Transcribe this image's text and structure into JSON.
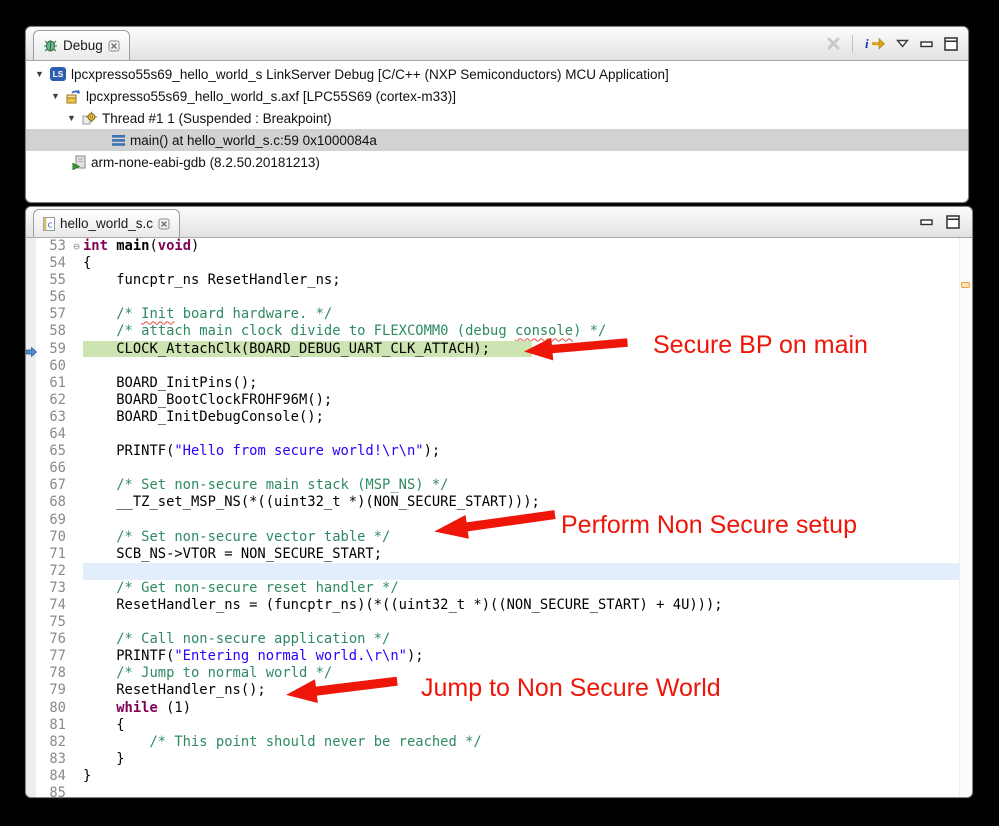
{
  "colors": {
    "annotation_red": "#ee1509",
    "exec_line_green": "#cde4b2",
    "current_line_blue": "#e2eefb",
    "selected_row_gray": "#d2d2d2",
    "keyword_purple": "#7f0055",
    "comment_green": "#2f8a62",
    "string_blue": "#2a00ff",
    "overview_marker_orange": "#efa23a"
  },
  "debug_view": {
    "tab_label": "Debug",
    "toolbar_icons": [
      "remove-all-terminated",
      "restart-i-arrow",
      "view-menu",
      "minimize",
      "maximize"
    ],
    "tree": [
      {
        "icon": "linkserver",
        "pad": 8,
        "expanded": true,
        "label": "lpcxpresso55s69_hello_world_s LinkServer Debug [C/C++ (NXP Semiconductors) MCU Application]"
      },
      {
        "icon": "executable",
        "pad": 24,
        "expanded": true,
        "label": "lpcxpresso55s69_hello_world_s.axf [LPC55S69 (cortex-m33)]"
      },
      {
        "icon": "thread",
        "pad": 40,
        "expanded": true,
        "label": "Thread #1 1 (Suspended : Breakpoint)"
      },
      {
        "icon": "stack-frame",
        "pad": 86,
        "selected": true,
        "label": "main() at hello_world_s.c:59 0x1000084a"
      },
      {
        "icon": "gdb-process",
        "pad": 46,
        "label": "arm-none-eabi-gdb (8.2.50.20181213)"
      }
    ]
  },
  "editor": {
    "tab_label": "hello_world_s.c",
    "window_icons": [
      "minimize",
      "maximize"
    ],
    "lines": [
      {
        "num": 53,
        "fold": "⊖",
        "segs": [
          [
            "k",
            "int"
          ],
          [
            "p",
            " "
          ],
          [
            "b",
            "main"
          ],
          [
            "p",
            "("
          ],
          [
            "k",
            "void"
          ],
          [
            "p",
            ")"
          ]
        ]
      },
      {
        "num": 54,
        "segs": [
          [
            "p",
            "{"
          ]
        ]
      },
      {
        "num": 55,
        "segs": [
          [
            "p",
            "    funcptr_ns ResetHandler_ns;"
          ]
        ]
      },
      {
        "num": 56,
        "segs": []
      },
      {
        "num": 57,
        "segs": [
          [
            "p",
            "    "
          ],
          [
            "c",
            "/* "
          ],
          [
            "ce",
            "Init"
          ],
          [
            "c",
            " board hardware. */"
          ]
        ]
      },
      {
        "num": 58,
        "segs": [
          [
            "p",
            "    "
          ],
          [
            "c",
            "/* attach main clock divide to FLEXCOMM0 (debug "
          ],
          [
            "ce",
            "console"
          ],
          [
            "c",
            ") */"
          ]
        ]
      },
      {
        "num": 59,
        "hl": "exec",
        "pointer": true,
        "segs": [
          [
            "p",
            "    CLOCK_AttachClk(BOARD_DEBUG_UART_CLK_ATTACH);"
          ]
        ]
      },
      {
        "num": 60,
        "segs": []
      },
      {
        "num": 61,
        "segs": [
          [
            "p",
            "    BOARD_InitPins();"
          ]
        ]
      },
      {
        "num": 62,
        "segs": [
          [
            "p",
            "    BOARD_BootClockFROHF96M();"
          ]
        ]
      },
      {
        "num": 63,
        "segs": [
          [
            "p",
            "    BOARD_InitDebugConsole();"
          ]
        ]
      },
      {
        "num": 64,
        "segs": []
      },
      {
        "num": 65,
        "segs": [
          [
            "p",
            "    PRINTF("
          ],
          [
            "s",
            "\"Hello from secure world!\\r\\n\""
          ],
          [
            "p",
            ");"
          ]
        ]
      },
      {
        "num": 66,
        "segs": []
      },
      {
        "num": 67,
        "segs": [
          [
            "p",
            "    "
          ],
          [
            "c",
            "/* Set non-secure main stack (MSP_NS) */"
          ]
        ]
      },
      {
        "num": 68,
        "segs": [
          [
            "p",
            "    __TZ_set_MSP_NS(*((uint32_t *)(NON_SECURE_START)));"
          ]
        ]
      },
      {
        "num": 69,
        "segs": []
      },
      {
        "num": 70,
        "segs": [
          [
            "p",
            "    "
          ],
          [
            "c",
            "/* Set non-secure vector table */"
          ]
        ]
      },
      {
        "num": 71,
        "segs": [
          [
            "p",
            "    SCB_NS->VTOR = NON_SECURE_START;"
          ]
        ]
      },
      {
        "num": 72,
        "hl": "cur",
        "segs": []
      },
      {
        "num": 73,
        "segs": [
          [
            "p",
            "    "
          ],
          [
            "c",
            "/* Get non-secure reset handler */"
          ]
        ]
      },
      {
        "num": 74,
        "segs": [
          [
            "p",
            "    ResetHandler_ns = (funcptr_ns)(*((uint32_t *)((NON_SECURE_START) + 4U)));"
          ]
        ]
      },
      {
        "num": 75,
        "segs": []
      },
      {
        "num": 76,
        "segs": [
          [
            "p",
            "    "
          ],
          [
            "c",
            "/* Call non-secure application */"
          ]
        ]
      },
      {
        "num": 77,
        "segs": [
          [
            "p",
            "    PRINTF("
          ],
          [
            "s",
            "\"Entering normal world.\\r\\n\""
          ],
          [
            "p",
            ");"
          ]
        ]
      },
      {
        "num": 78,
        "segs": [
          [
            "p",
            "    "
          ],
          [
            "c",
            "/* Jump to normal world */"
          ]
        ]
      },
      {
        "num": 79,
        "segs": [
          [
            "p",
            "    ResetHandler_ns();"
          ]
        ]
      },
      {
        "num": 80,
        "segs": [
          [
            "p",
            "    "
          ],
          [
            "k",
            "while"
          ],
          [
            "p",
            " (1)"
          ]
        ]
      },
      {
        "num": 81,
        "segs": [
          [
            "p",
            "    {"
          ]
        ]
      },
      {
        "num": 82,
        "segs": [
          [
            "p",
            "        "
          ],
          [
            "c",
            "/* This point should never be reached */"
          ]
        ]
      },
      {
        "num": 83,
        "segs": [
          [
            "p",
            "    }"
          ]
        ]
      },
      {
        "num": 84,
        "segs": [
          [
            "p",
            "}"
          ]
        ]
      },
      {
        "num": 85,
        "segs": []
      }
    ]
  },
  "annotations": [
    {
      "text": "Secure BP on main"
    },
    {
      "text": "Perform Non Secure setup"
    },
    {
      "text": "Jump to Non Secure World"
    }
  ]
}
